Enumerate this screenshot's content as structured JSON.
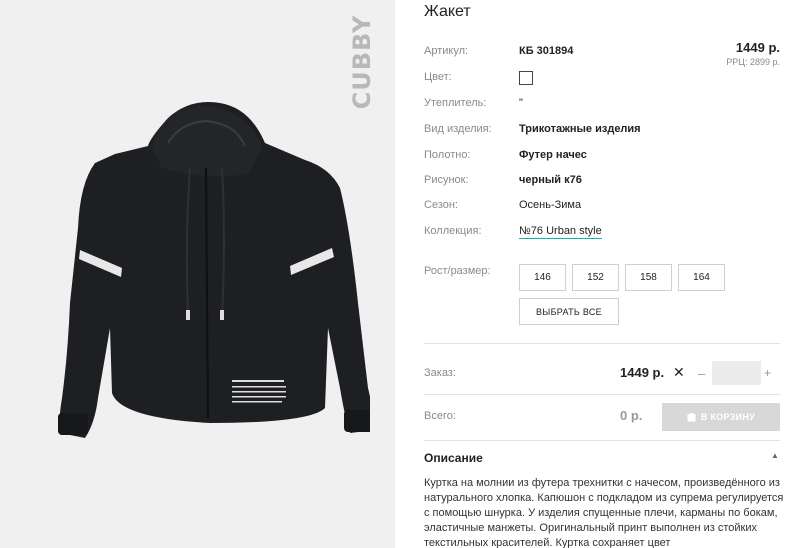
{
  "product": {
    "title": "Жакет",
    "brand": "CUBBY",
    "price": "1449 р.",
    "rrc": "РРЦ: 2899 р."
  },
  "attributes": [
    {
      "label": "Артикул:",
      "value": "КБ 301894"
    },
    {
      "label": "Цвет:",
      "value": ""
    },
    {
      "label": "Утеплитель:",
      "value": "\""
    },
    {
      "label": "Вид изделия:",
      "value": "Трикотажные изделия"
    },
    {
      "label": "Полотно:",
      "value": "Футер начес"
    },
    {
      "label": "Рисунок:",
      "value": "черный к76"
    },
    {
      "label": "Сезон:",
      "value": "Осень-Зима"
    },
    {
      "label": "Коллекция:",
      "value": "№76 Urban style"
    }
  ],
  "sizes": {
    "label": "Рост/размер:",
    "options": [
      "146",
      "152",
      "158",
      "164"
    ],
    "select_all": "ВЫБРАТЬ ВСЕ"
  },
  "order": {
    "label": "Заказ:",
    "price": "1449 р.",
    "times": "✕",
    "minus": "–",
    "plus": "+",
    "quantity": ""
  },
  "total": {
    "label": "Всего:",
    "value": "0 р.",
    "cart_button": "В КОРЗИНУ"
  },
  "description": {
    "title": "Описание",
    "text": "Куртка на молнии из футера трехнитки с начесом, произведённого из натурального хлопка. Капюшон с подкладом из супрема регулируется с помощью шнурка. У изделия спущенные плечи, карманы по бокам, эластичные манжеты. Оригинальный принт выполнен из стойких текстильных красителей. Куртка сохраняет цвет"
  },
  "colors": {
    "accent_link": "#4a9a9a",
    "jacket": "#1d1f22",
    "button_disabled": "#d8d8d8"
  }
}
